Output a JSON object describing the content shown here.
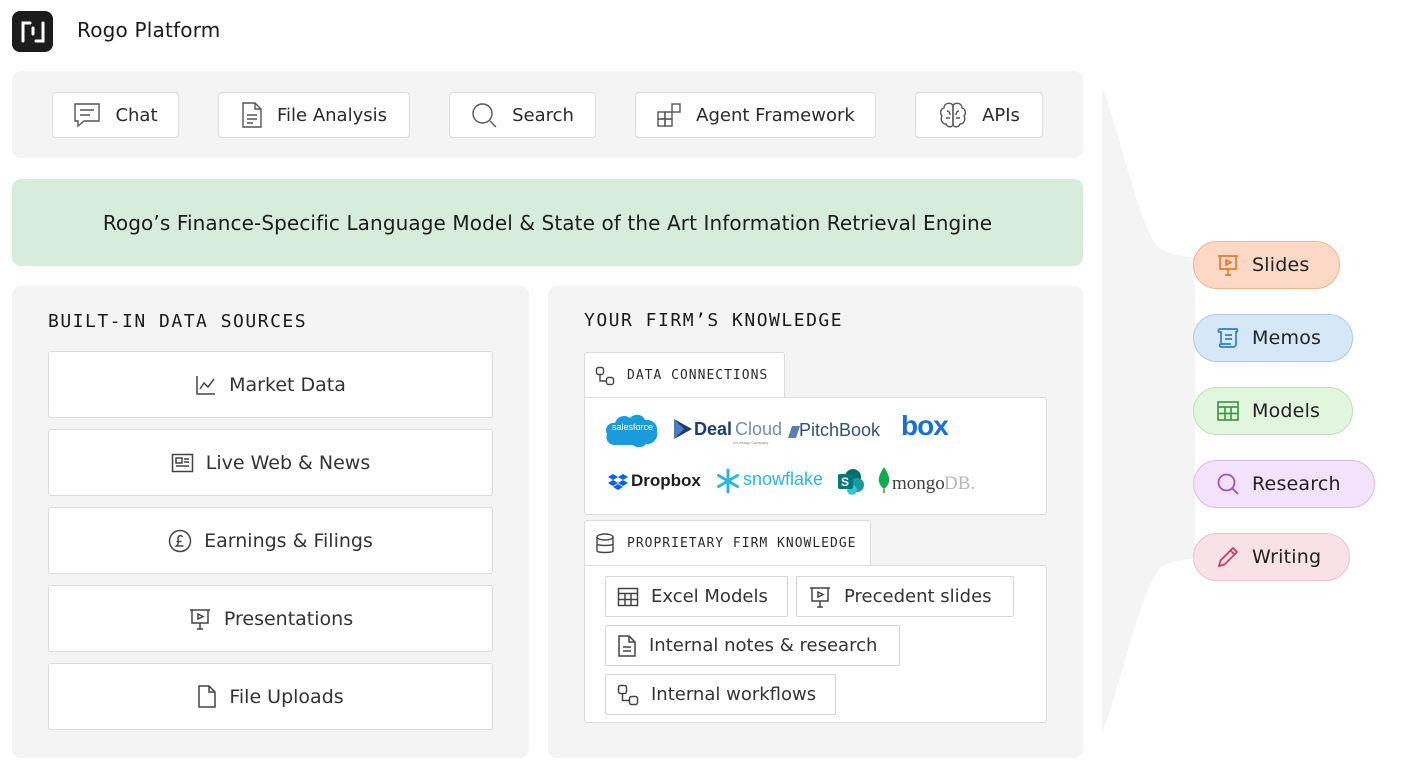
{
  "header": {
    "title": "Rogo Platform",
    "logo_icon": "rogo-logo-icon"
  },
  "tools": [
    {
      "label": "Chat",
      "icon": "chat-icon"
    },
    {
      "label": "File Analysis",
      "icon": "file-icon"
    },
    {
      "label": "Search",
      "icon": "search-icon"
    },
    {
      "label": "Agent Framework",
      "icon": "agent-grid-icon"
    },
    {
      "label": "APIs",
      "icon": "brain-icon"
    }
  ],
  "engine": {
    "text": "Rogo’s Finance-Specific Language Model & State of the Art Information Retrieval Engine"
  },
  "builtin": {
    "heading": "BUILT-IN DATA SOURCES",
    "sources": [
      {
        "label": "Market Data",
        "icon": "line-chart-icon"
      },
      {
        "label": "Live Web & News",
        "icon": "newspaper-icon"
      },
      {
        "label": "Earnings & Filings",
        "icon": "pound-coin-icon"
      },
      {
        "label": "Presentations",
        "icon": "presentation-icon"
      },
      {
        "label": "File Uploads",
        "icon": "file-icon"
      }
    ]
  },
  "firm": {
    "heading": "YOUR FIRM’S KNOWLEDGE",
    "connections": {
      "label": "DATA CONNECTIONS",
      "logos": {
        "salesforce": "salesforce",
        "dealcloud_a": "Deal",
        "dealcloud_b": "Cloud",
        "dealcloud_sub": "An Intapp Company",
        "pitchbook": "PitchBook",
        "box": "box",
        "dropbox": "Dropbox",
        "snowflake": "snowflake",
        "sharepoint": "S",
        "mongodb_a": "mongo",
        "mongodb_b": "DB."
      }
    },
    "proprietary": {
      "label": "PROPRIETARY FIRM KNOWLEDGE",
      "items": [
        {
          "label": "Excel Models",
          "icon": "table-icon"
        },
        {
          "label": "Precedent slides",
          "icon": "presentation-icon"
        },
        {
          "label": "Internal notes & research",
          "icon": "document-icon"
        },
        {
          "label": "Internal workflows",
          "icon": "workflow-icon"
        }
      ]
    }
  },
  "outputs": [
    {
      "label": "Slides",
      "icon": "presentation-icon",
      "bg": "#fbd9c6",
      "border": "#f2b48c",
      "color": "#e8792c"
    },
    {
      "label": "Memos",
      "icon": "scroll-icon",
      "bg": "#d6e8f8",
      "border": "#a9cdea",
      "color": "#2f7fc0"
    },
    {
      "label": "Models",
      "icon": "table-icon",
      "bg": "#e2f6df",
      "border": "#b9e3b1",
      "color": "#3d9a45"
    },
    {
      "label": "Research",
      "icon": "search-icon",
      "bg": "#f3e2fb",
      "border": "#dcb9ef",
      "color": "#a249d0"
    },
    {
      "label": "Writing",
      "icon": "pencil-icon",
      "bg": "#f8e2e7",
      "border": "#ecbfca",
      "color": "#c73a61"
    }
  ]
}
